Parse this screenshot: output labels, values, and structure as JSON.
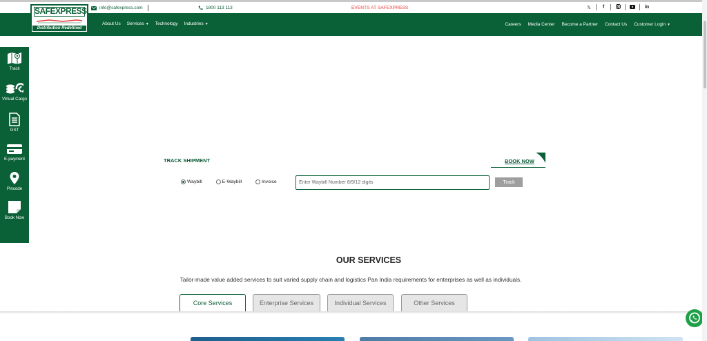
{
  "topbar": {
    "email": "info@safexpress.com",
    "phone": "1800 113 113",
    "events": "EVENTS AT SAFEXPRESS",
    "social_icons": [
      "x-icon",
      "facebook-icon",
      "instagram-icon",
      "youtube-icon",
      "linkedin-icon"
    ]
  },
  "logo": {
    "name": "SAFEXPRESS",
    "tagline": "Distribution Redefined"
  },
  "nav": {
    "left": [
      {
        "label": "About Us",
        "dropdown": false
      },
      {
        "label": "Services",
        "dropdown": true
      },
      {
        "label": "Technology",
        "dropdown": false
      },
      {
        "label": "Industries",
        "dropdown": true
      }
    ],
    "right": [
      {
        "label": "Careers",
        "dropdown": false
      },
      {
        "label": "Media Center",
        "dropdown": false
      },
      {
        "label": "Become a Partner",
        "dropdown": false
      },
      {
        "label": "Contact Us",
        "dropdown": false
      },
      {
        "label": "Customer Login",
        "dropdown": true
      }
    ]
  },
  "sidebar": {
    "items": [
      {
        "label": "Track",
        "icon": "map-icon"
      },
      {
        "label": "Virtual Cargo",
        "icon": "cargo-icon"
      },
      {
        "label": "GST",
        "icon": "document-icon"
      },
      {
        "label": "E-payment",
        "icon": "card-icon"
      },
      {
        "label": "Pincode",
        "icon": "location-pin-icon"
      },
      {
        "label": "Book Now",
        "icon": "note-icon"
      }
    ]
  },
  "track": {
    "title": "TRACK SHIPMENT",
    "book_now": "BOOK NOW",
    "options": [
      {
        "label": "Waybill",
        "selected": true
      },
      {
        "label": "E-Waybill",
        "selected": false
      },
      {
        "label": "Invoice",
        "selected": false
      }
    ],
    "placeholder": "Enter Waybill Number 8/9/12 digits",
    "button": "Track"
  },
  "services": {
    "title": "OUR SERVICES",
    "subtitle": "Tailor-made value added services to suit varied supply chain and logistics Pan India requirements for enterprises as well as individuals.",
    "tabs": [
      {
        "label": "Core Services",
        "active": true
      },
      {
        "label": "Enterprise Services",
        "active": false
      },
      {
        "label": "Individual Services",
        "active": false
      },
      {
        "label": "Other Services",
        "active": false
      }
    ]
  },
  "colors": {
    "brand_green": "#0b6137",
    "events_red": "#e53935",
    "whatsapp_green": "#1ea049",
    "button_gray": "#9e9e9e"
  }
}
